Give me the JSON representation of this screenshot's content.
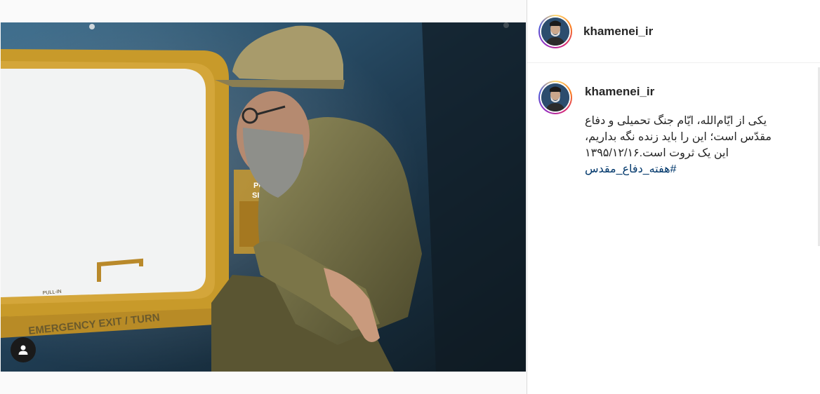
{
  "post": {
    "username": "khamenei_ir",
    "caption_lines": [
      "یکی از ایّام‌الله، ایّام جنگ تحمیلی و دفاع",
      "مقدّس است؛ این را باید زنده نگه بداریم،",
      "این یک ثروت است.۱۳۹۵/۱۲/۱۶"
    ],
    "hashtag": "#هفته_دفاع_مقدس",
    "photo": {
      "window_sign_1": "PUSH",
      "window_sign_2": "SLIDE",
      "exit_sign": "EMERGENCY EXIT / TURN",
      "pull_label": "PULL-IN"
    }
  },
  "comment": {
    "username": "khamenei_ir"
  },
  "icons": {
    "user_tag": "person-icon"
  },
  "colors": {
    "username": "#262626",
    "hashtag": "#00376b",
    "background": "#fafafa"
  }
}
